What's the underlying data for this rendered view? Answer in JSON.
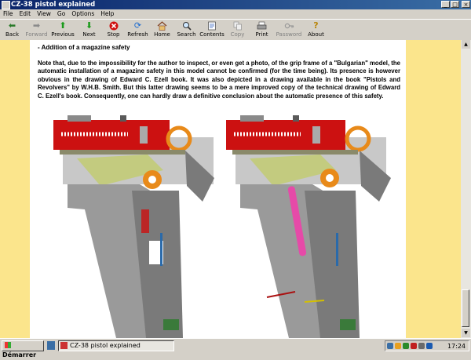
{
  "window": {
    "title": "CZ-38 pistol explained"
  },
  "menu": [
    "File",
    "Edit",
    "View",
    "Go",
    "Options",
    "Help"
  ],
  "toolbar": {
    "back": "Back",
    "forward": "Forward",
    "previous": "Previous",
    "next": "Next",
    "stop": "Stop",
    "refresh": "Refresh",
    "home": "Home",
    "search": "Search",
    "contents": "Contents",
    "copy": "Copy",
    "print": "Print",
    "password": "Password",
    "about": "About"
  },
  "icons": {
    "back": "arrow-left-icon",
    "forward": "arrow-right-icon",
    "previous": "arrow-up-icon",
    "next": "arrow-down-icon",
    "stop": "stop-icon",
    "refresh": "refresh-icon",
    "home": "home-icon",
    "search": "search-icon",
    "contents": "contents-icon",
    "copy": "copy-icon",
    "print": "print-icon",
    "password": "key-icon",
    "about": "help-icon"
  },
  "page": {
    "heading": "- Addition of a magazine safety",
    "paragraph": "Note that, due to the impossibility for the author to inspect, or even get a photo, of the grip frame of a \"Bulgarian\" model, the automatic installation of a magazine safety in this model cannot be confirmed (for the time being). Its presence is however obvious in the drawing of Edward C. Ezell book. It was also depicted in a drawing available in the book \"Pistols and Revolvers\" by W.H.B. Smith. But this latter drawing seems to be a mere improved copy of the technical drawing of Edward C. Ezell's book. Consequently, one can hardly draw a definitive conclusion about the automatic presence of this safety."
  },
  "colors": {
    "side_panel": "#fbe58c",
    "slide_red": "#cc1111",
    "hammer_orange": "#e88a1a",
    "magazine_safety_pink": "#e64aa8"
  },
  "taskbar": {
    "start": "Démarrer",
    "task": "CZ-38 pistol explained",
    "clock": "17:24"
  }
}
